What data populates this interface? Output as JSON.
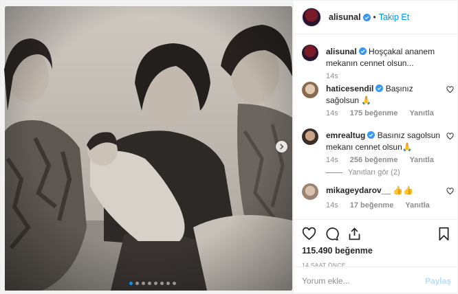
{
  "post": {
    "author": "alisunal",
    "follow_label": "Takip Et",
    "separator": "•",
    "carousel": {
      "slides": 8,
      "active": 0
    }
  },
  "caption": {
    "username": "alisunal",
    "text": "Hoşçakal ananem mekanın cennet olsun...",
    "time": "14s"
  },
  "comments": [
    {
      "username": "haticesendil",
      "text": "Başınız sağolsun 🙏",
      "time": "14s",
      "likes": "175 beğenme",
      "reply": "Yanıtla"
    },
    {
      "username": "emrealtug",
      "text": "Basınız sagolsun mekanı cennet olsun🙏",
      "time": "14s",
      "likes": "256 beğenme",
      "reply": "Yanıtla",
      "view_replies": "Yanıtları gör (2)"
    },
    {
      "username": "mikageydarov__",
      "text": "👍👍",
      "time": "14s",
      "likes": "17 beğenme",
      "reply": "Yanıtla"
    }
  ],
  "stats": {
    "likes": "115.490 beğenme",
    "posted": "14 SAAT ÖNCE"
  },
  "composer": {
    "placeholder": "Yorum ekle...",
    "post_label": "Paylaş"
  },
  "icons": [
    "verified-badge",
    "heart-icon",
    "comment-icon",
    "share-icon",
    "bookmark-icon",
    "chevron-right-icon"
  ],
  "colors": {
    "accent": "#0095f6",
    "muted": "#8e8e8e",
    "border": "#efefef"
  }
}
